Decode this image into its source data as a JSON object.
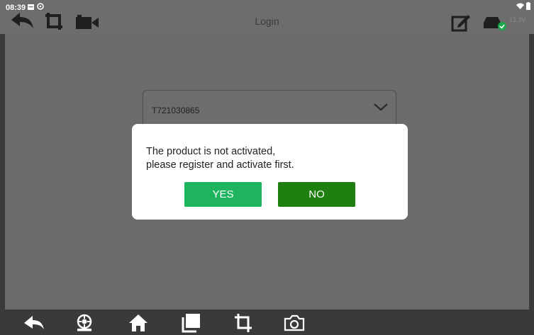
{
  "status_bar": {
    "time": "08:39",
    "voltage": "12.3V"
  },
  "header": {
    "title": "Login"
  },
  "login": {
    "serial_number": "T721030865"
  },
  "dialog": {
    "message_line1": "The product is not activated,",
    "message_line2": "please register and activate first.",
    "yes_label": "YES",
    "no_label": "NO"
  },
  "colors": {
    "yes_button": "#1eb45e",
    "no_button": "#1e7e10",
    "overlay": "#6b6b6b"
  },
  "icons": {
    "header_left": [
      "back-arrow-icon",
      "crop-icon",
      "video-camera-icon"
    ],
    "header_right": [
      "edit-icon",
      "car-connected-icon"
    ],
    "nav": [
      "back-icon",
      "diagnostic-icon",
      "home-icon",
      "recent-apps-icon",
      "screenshot-crop-icon",
      "camera-icon"
    ]
  }
}
